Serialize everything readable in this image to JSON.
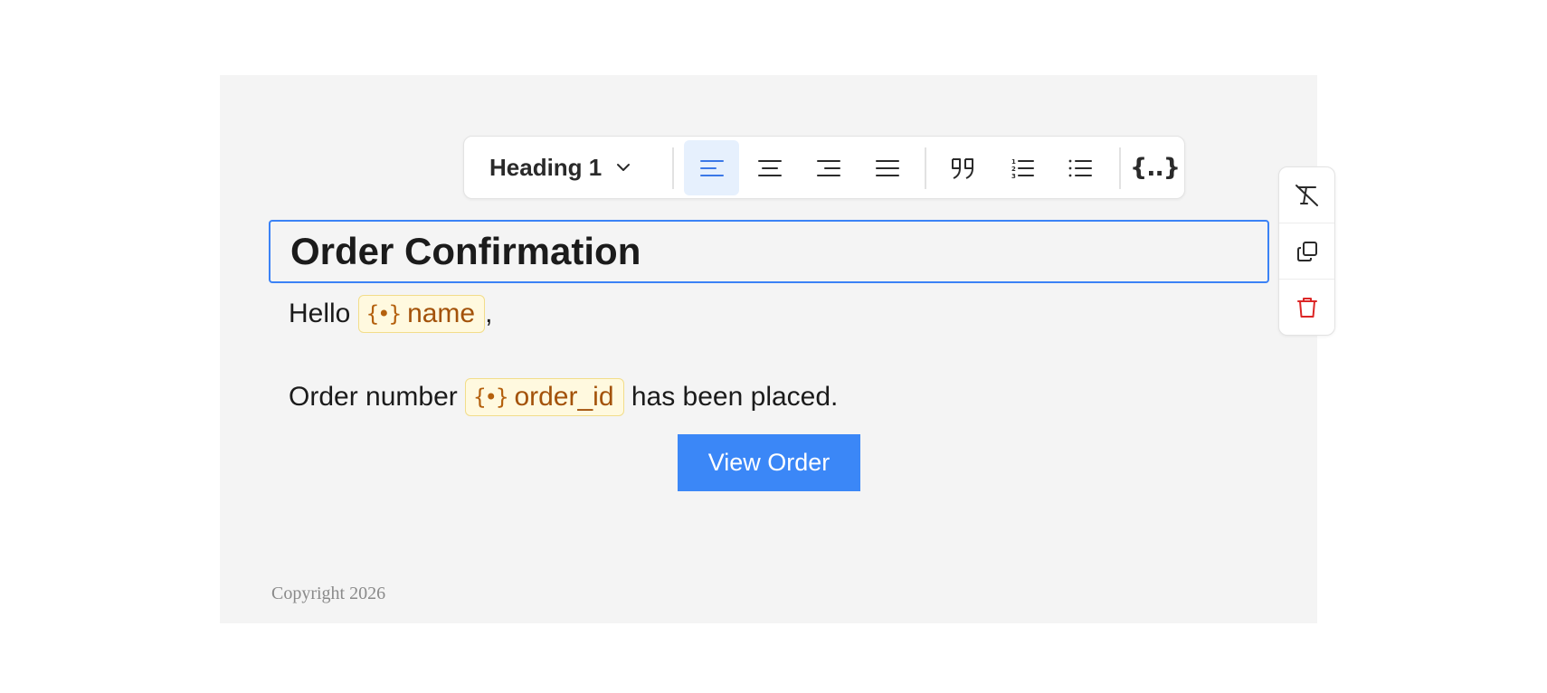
{
  "toolbar": {
    "block_style": "Heading 1",
    "buttons": [
      {
        "name": "align-left",
        "active": true
      },
      {
        "name": "align-center",
        "active": false
      },
      {
        "name": "align-right",
        "active": false
      },
      {
        "name": "align-justify",
        "active": false
      },
      {
        "name": "blockquote",
        "active": false
      },
      {
        "name": "ordered-list",
        "active": false
      },
      {
        "name": "bullet-list",
        "active": false
      }
    ],
    "variable_label": "{..}"
  },
  "content": {
    "heading": "Order Confirmation",
    "greeting_prefix": "Hello ",
    "greeting_variable": "name",
    "greeting_suffix": ",",
    "order_prefix": "Order number ",
    "order_variable": "order_id",
    "order_suffix": " has been placed.",
    "button_label": "View Order",
    "footer": "Copyright 2026"
  },
  "side_actions": [
    "clear-formatting-icon",
    "duplicate-icon",
    "delete-icon"
  ],
  "colors": {
    "accent": "#3b82f6",
    "button": "#3b87f7",
    "chip_bg": "#fff9df",
    "chip_text": "#a3520a",
    "delete": "#dc2626"
  }
}
